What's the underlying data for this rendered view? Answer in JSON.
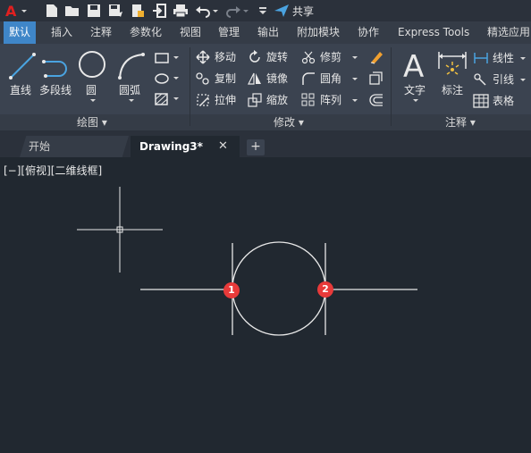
{
  "quick_access": {
    "share_label": "共享",
    "icons": [
      "autocad-logo-icon",
      "new-file-icon",
      "open-folder-icon",
      "save-icon",
      "save-as-icon",
      "publish-icon",
      "import-icon",
      "export-icon",
      "print-icon",
      "undo-icon",
      "redo-icon",
      "dropdown-icon",
      "share-icon"
    ]
  },
  "tabs": [
    "默认",
    "插入",
    "注释",
    "参数化",
    "视图",
    "管理",
    "输出",
    "附加模块",
    "协作",
    "Express Tools",
    "精选应用"
  ],
  "active_tab": "默认",
  "draw_panel": {
    "title": "绘图",
    "tools": [
      "直线",
      "多段线",
      "圆",
      "圆弧"
    ]
  },
  "modify_panel": {
    "title": "修改",
    "rows": [
      [
        "移动",
        "旋转",
        "修剪"
      ],
      [
        "复制",
        "镜像",
        "圆角"
      ],
      [
        "拉伸",
        "缩放",
        "阵列"
      ]
    ]
  },
  "annotation_panel": {
    "title": "注释",
    "big_tools": [
      "文字",
      "标注"
    ],
    "small_tools": [
      "线性",
      "引线",
      "表格"
    ]
  },
  "doc_tabs": {
    "start": "开始",
    "drawing": "Drawing3*",
    "close": "✕",
    "add": "+"
  },
  "viewport": {
    "label": "[−][俯视][二维线框]",
    "markers": [
      "1",
      "2"
    ]
  },
  "colors": {
    "background": "#212830",
    "ribbon": "#3b4350",
    "active_tab": "#3f86c8",
    "marker": "#e83a3a",
    "accent_blue": "#4aa3e0"
  }
}
